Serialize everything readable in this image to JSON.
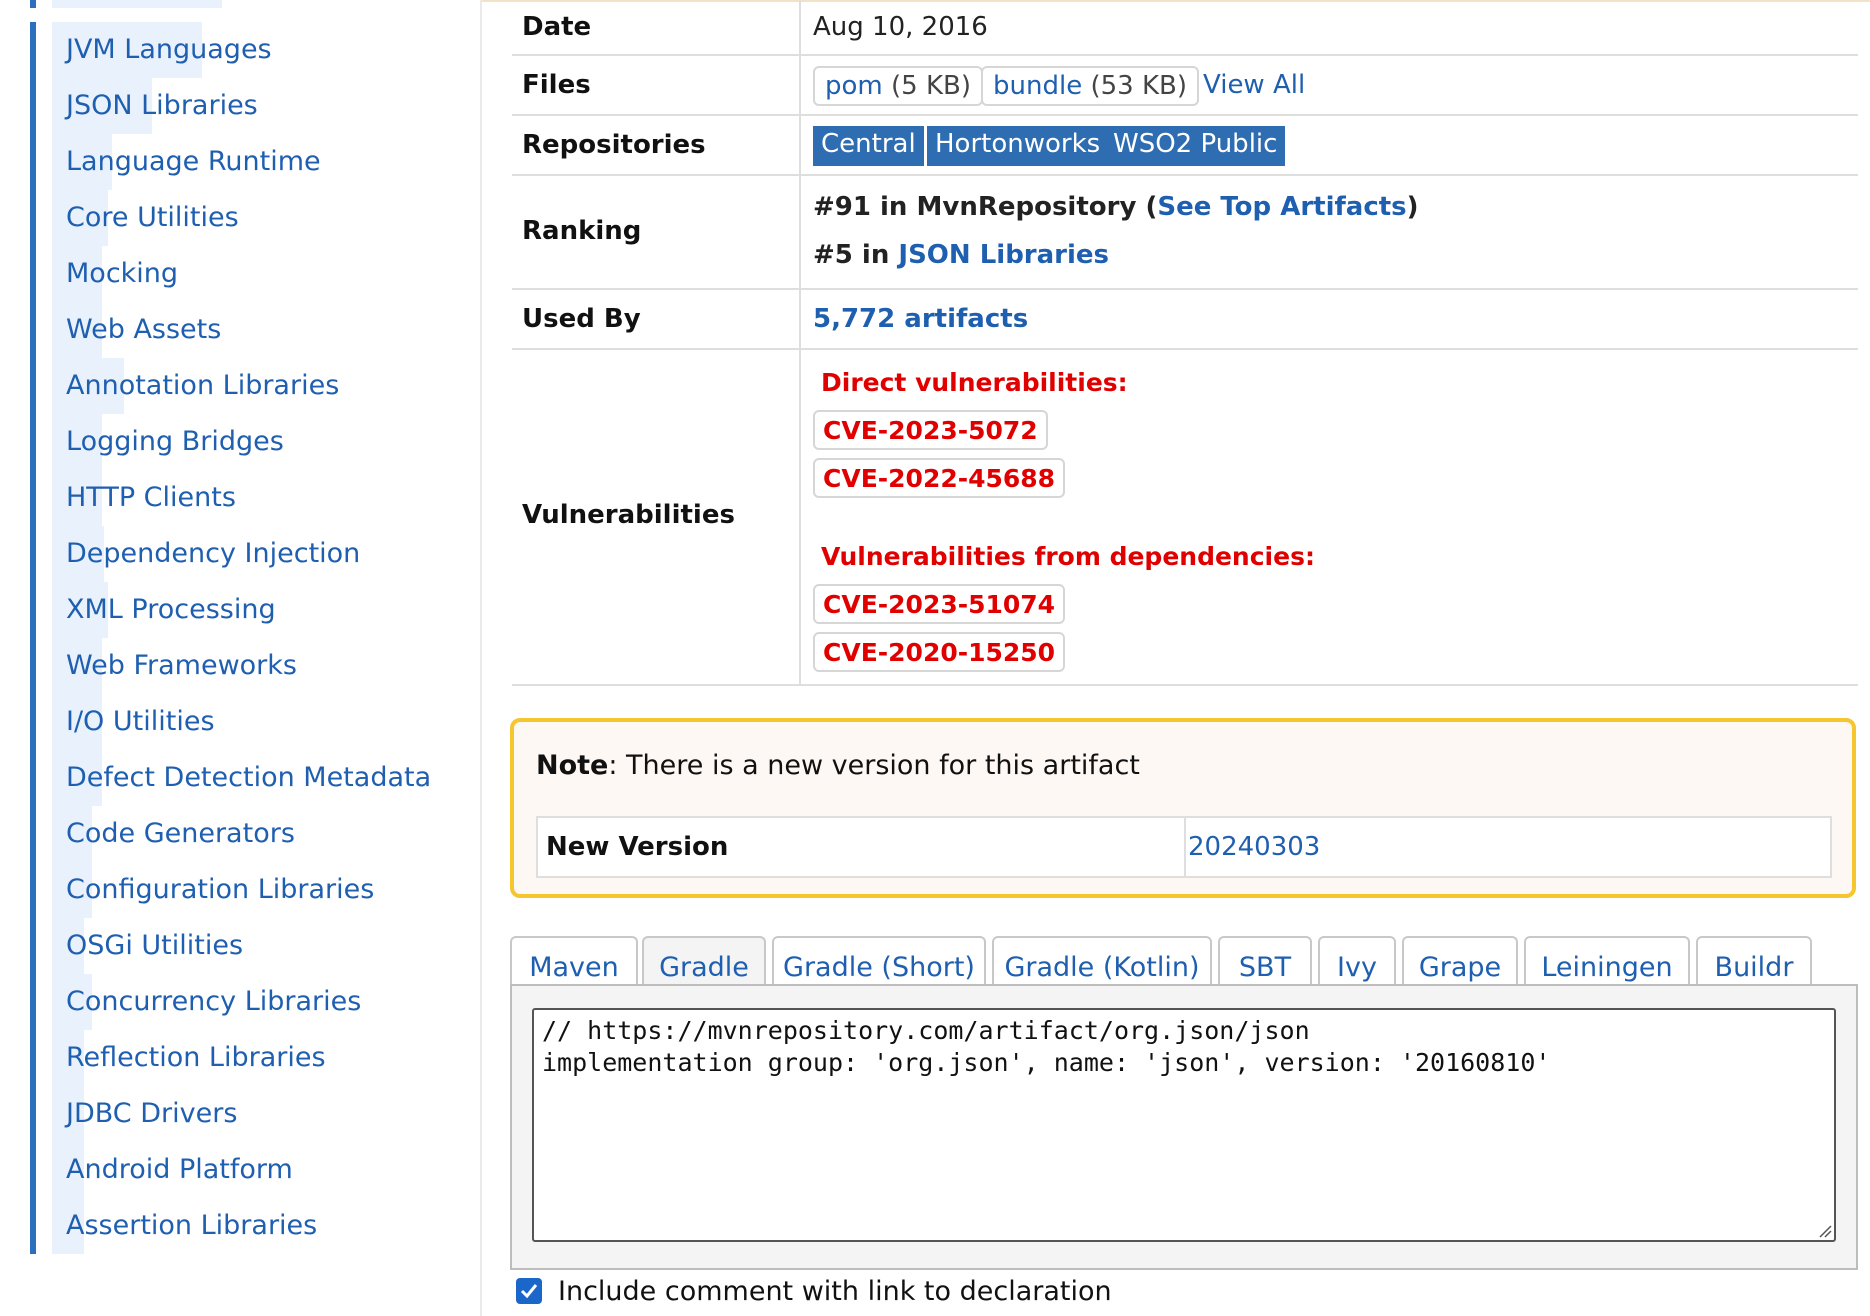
{
  "sidebar": {
    "items": [
      {
        "label": "JVM Languages"
      },
      {
        "label": "JSON Libraries"
      },
      {
        "label": "Language Runtime"
      },
      {
        "label": "Core Utilities"
      },
      {
        "label": "Mocking"
      },
      {
        "label": "Web Assets"
      },
      {
        "label": "Annotation Libraries"
      },
      {
        "label": "Logging Bridges"
      },
      {
        "label": "HTTP Clients"
      },
      {
        "label": "Dependency Injection"
      },
      {
        "label": "XML Processing"
      },
      {
        "label": "Web Frameworks"
      },
      {
        "label": "I/O Utilities"
      },
      {
        "label": "Defect Detection Metadata"
      },
      {
        "label": "Code Generators"
      },
      {
        "label": "Configuration Libraries"
      },
      {
        "label": "OSGi Utilities"
      },
      {
        "label": "Concurrency Libraries"
      },
      {
        "label": "Reflection Libraries"
      },
      {
        "label": "JDBC Drivers"
      },
      {
        "label": "Android Platform"
      },
      {
        "label": "Assertion Libraries"
      }
    ]
  },
  "details": {
    "date": {
      "label": "Date",
      "value": "Aug 10, 2016"
    },
    "files": {
      "label": "Files",
      "pom": {
        "name": "pom",
        "size": "(5 KB)"
      },
      "bundle": {
        "name": "bundle",
        "size": "(53 KB)"
      },
      "view_all": "View All"
    },
    "repositories": {
      "label": "Repositories",
      "items": [
        "Central",
        "Hortonworks",
        "WSO2 Public"
      ]
    },
    "ranking": {
      "label": "Ranking",
      "line1_prefix": "#91 in MvnRepository (",
      "line1_link": "See Top Artifacts",
      "line1_suffix": ")",
      "line2_prefix": "#5 in ",
      "line2_link": "JSON Libraries"
    },
    "used_by": {
      "label": "Used By",
      "value": "5,772 artifacts"
    },
    "vulnerabilities": {
      "label": "Vulnerabilities",
      "direct_heading": "Direct vulnerabilities:",
      "direct": [
        "CVE-2023-5072",
        "CVE-2022-45688"
      ],
      "deps_heading": "Vulnerabilities from dependencies:",
      "deps": [
        "CVE-2023-51074",
        "CVE-2020-15250"
      ]
    }
  },
  "note": {
    "strong": "Note",
    "text": ": There is a new version for this artifact",
    "new_version_label": "New Version",
    "new_version_value": "20240303"
  },
  "tabs": {
    "items": [
      "Maven",
      "Gradle",
      "Gradle (Short)",
      "Gradle (Kotlin)",
      "SBT",
      "Ivy",
      "Grape",
      "Leiningen",
      "Buildr"
    ],
    "active": "Gradle"
  },
  "snippet": {
    "line1": "// https://mvnrepository.com/artifact/org.json/json",
    "line2": "implementation group: 'org.json', name: 'json', version: '20160810'"
  },
  "include_comment": {
    "label": "Include comment with link to declaration",
    "checked": true
  },
  "colors": {
    "link": "#1f5fb0",
    "repo_bg": "#2f6db2",
    "vuln": "#e00000",
    "note_border": "#f5c630"
  }
}
